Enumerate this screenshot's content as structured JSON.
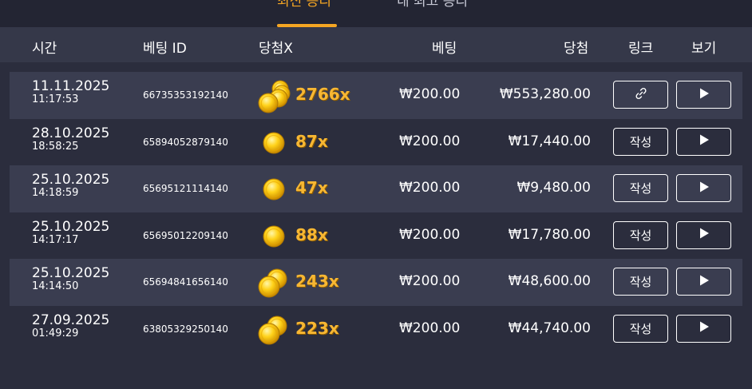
{
  "tabs": [
    {
      "label": "최신 승리",
      "active": true
    },
    {
      "label": "내 최고 승리",
      "active": false
    }
  ],
  "header": {
    "time": "시간",
    "bet_id": "베팅 ID",
    "multiplier": "당첨X",
    "bet": "베팅",
    "win": "당첨",
    "link": "링크",
    "view": "보기"
  },
  "rows": [
    {
      "date": "11.11.2025",
      "time": "11:17:53",
      "bet_id": "66735353192140",
      "coin_icon": "coin-stack-icon",
      "multiplier": "2766x",
      "bet": "₩200.00",
      "win": "₩553,280.00",
      "link_type": "icon",
      "link_label": "",
      "link_icon": "link-icon"
    },
    {
      "date": "28.10.2025",
      "time": "18:58:25",
      "bet_id": "65894052879140",
      "coin_icon": "coin-icon",
      "multiplier": "87x",
      "bet": "₩200.00",
      "win": "₩17,440.00",
      "link_type": "text",
      "link_label": "작성"
    },
    {
      "date": "25.10.2025",
      "time": "14:18:59",
      "bet_id": "65695121114140",
      "coin_icon": "coin-icon",
      "multiplier": "47x",
      "bet": "₩200.00",
      "win": "₩9,480.00",
      "link_type": "text",
      "link_label": "작성"
    },
    {
      "date": "25.10.2025",
      "time": "14:17:17",
      "bet_id": "65695012209140",
      "coin_icon": "coin-icon",
      "multiplier": "88x",
      "bet": "₩200.00",
      "win": "₩17,780.00",
      "link_type": "text",
      "link_label": "작성"
    },
    {
      "date": "25.10.2025",
      "time": "14:14:50",
      "bet_id": "65694841656140",
      "coin_icon": "coin-pair-icon",
      "multiplier": "243x",
      "bet": "₩200.00",
      "win": "₩48,600.00",
      "link_type": "text",
      "link_label": "작성"
    },
    {
      "date": "27.09.2025",
      "time": "01:49:29",
      "bet_id": "63805329250140",
      "coin_icon": "coin-pair-icon",
      "multiplier": "223x",
      "bet": "₩200.00",
      "win": "₩44,740.00",
      "link_type": "text",
      "link_label": "작성"
    }
  ],
  "colors": {
    "accent": "#f5a623",
    "background": "#2b2d3d",
    "row_alt": "#3a3d50",
    "header": "#353849"
  }
}
